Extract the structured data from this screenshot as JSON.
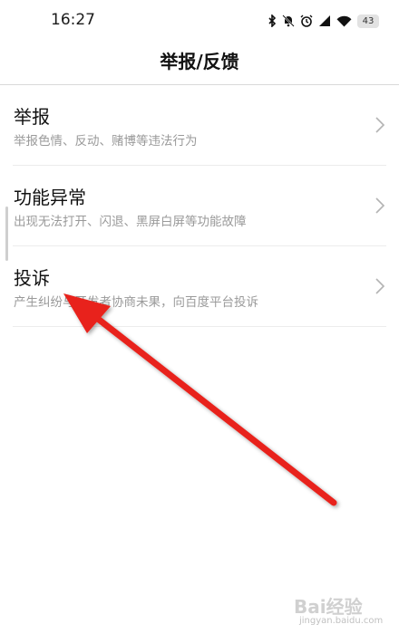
{
  "status_bar": {
    "time": "16:27",
    "battery": "43",
    "icons": [
      "bluetooth-icon",
      "mute-bell-icon",
      "alarm-icon",
      "signal-icon",
      "wifi-icon",
      "battery-icon"
    ]
  },
  "header": {
    "title": "举报/反馈"
  },
  "list": {
    "items": [
      {
        "title": "举报",
        "description": "举报色情、反动、赌博等违法行为"
      },
      {
        "title": "功能异常",
        "description": "出现无法打开、闪退、黑屏白屏等功能故障"
      },
      {
        "title": "投诉",
        "description": "产生纠纷与开发者协商未果，向百度平台投诉"
      }
    ]
  },
  "annotation": {
    "arrow_color": "#e8211a"
  },
  "watermark": {
    "text": "Bai经验",
    "sub": "jingyan.baidu.com"
  }
}
